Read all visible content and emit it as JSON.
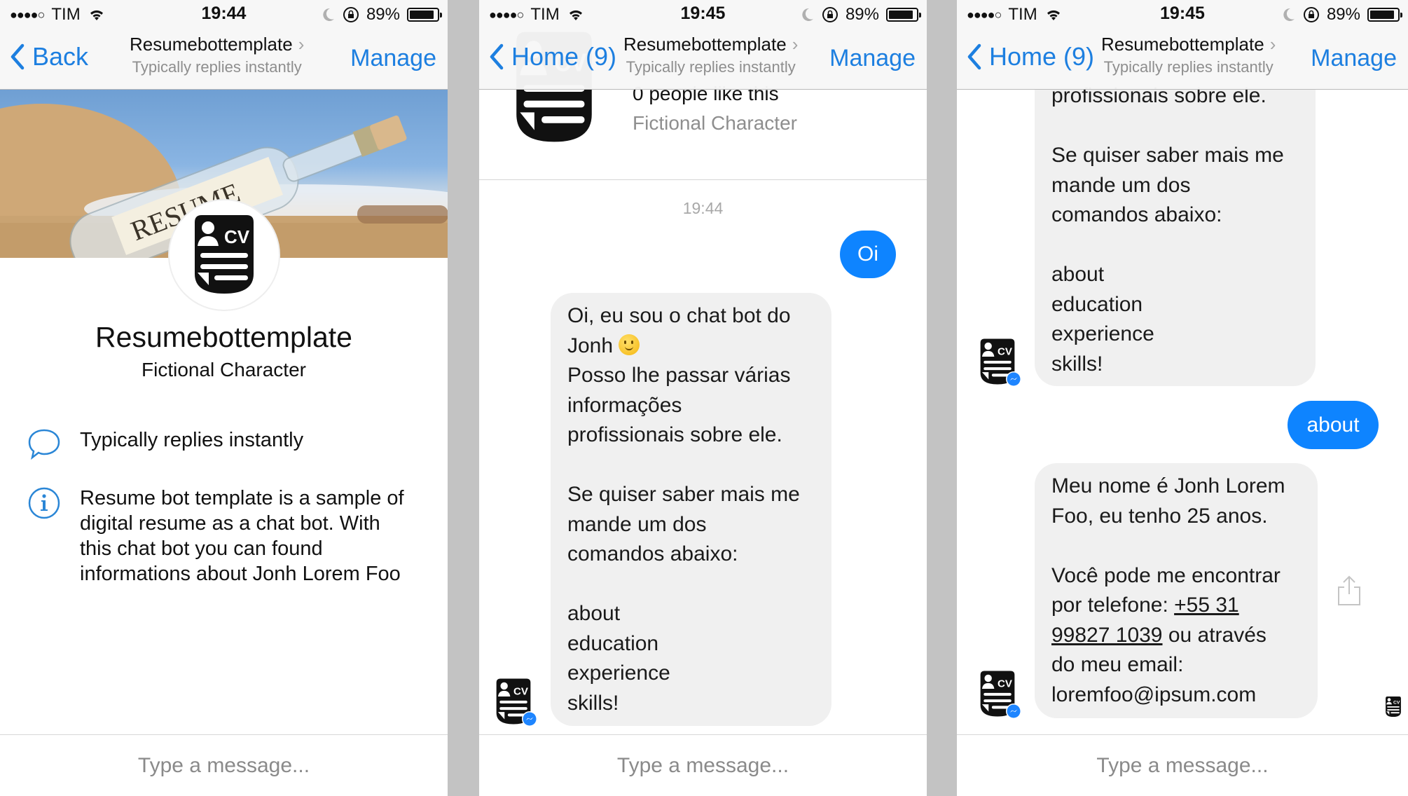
{
  "panels": [
    {
      "status": {
        "carrier": "TIM",
        "time": "19:44",
        "battery": "89%",
        "battery_level": 0.89
      },
      "nav": {
        "back_label": "Back",
        "title": "Resumebottemplate",
        "subtitle": "Typically replies instantly",
        "manage_label": "Manage"
      },
      "profile": {
        "name": "Resumebottemplate",
        "category": "Fictional Character",
        "cover_text": "RESUME",
        "info": [
          {
            "icon": "chat-bubble-icon",
            "text": "Typically replies instantly"
          },
          {
            "icon": "info-icon",
            "text": "Resume bot template is a sample of digital resume as a chat bot. With this chat bot you can found informations about Jonh Lorem Foo"
          }
        ]
      },
      "composer": {
        "placeholder": "Type a message..."
      }
    },
    {
      "status": {
        "carrier": "TIM",
        "time": "19:45",
        "battery": "89%",
        "battery_level": 0.89
      },
      "nav": {
        "back_label": "Home (9)",
        "title": "Resumebottemplate",
        "subtitle": "Typically replies instantly",
        "manage_label": "Manage"
      },
      "profile_strip": {
        "likes": "0 people like this",
        "category": "Fictional Character"
      },
      "timestamp": "19:44",
      "messages": [
        {
          "from": "user",
          "text": "Oi"
        },
        {
          "from": "bot",
          "line1": "Oi, eu sou o chat bot do",
          "line2": "Jonh",
          "rest": "Posso lhe passar várias\ninformações\nprofissionais sobre ele.\n\nSe quiser saber mais me\nmande um dos\ncomandos abaixo:\n\nabout\neducation\nexperience\nskills!"
        }
      ],
      "composer": {
        "placeholder": "Type a message..."
      }
    },
    {
      "status": {
        "carrier": "TIM",
        "time": "19:45",
        "battery": "89%",
        "battery_level": 0.89
      },
      "nav": {
        "back_label": "Home (9)",
        "title": "Resumebottemplate",
        "subtitle": "Typically replies instantly",
        "manage_label": "Manage"
      },
      "messages": [
        {
          "from": "bot",
          "text": "profissionais sobre ele.\n\nSe quiser saber mais me\nmande um dos\ncomandos abaixo:\n\nabout\neducation\nexperience\nskills!"
        },
        {
          "from": "user",
          "text": "about"
        },
        {
          "from": "bot",
          "intro": "Meu nome é Jonh Lorem\nFoo, eu tenho 25 anos.\n\nVocê pode me encontrar\npor telefone: ",
          "phone_a": "+55 31",
          "phone_b": "99827 1039",
          "after_phone": " ou através\ndo meu email:\n",
          "email": "loremfoo@ipsum.com"
        }
      ],
      "composer": {
        "placeholder": "Type a message..."
      }
    }
  ]
}
